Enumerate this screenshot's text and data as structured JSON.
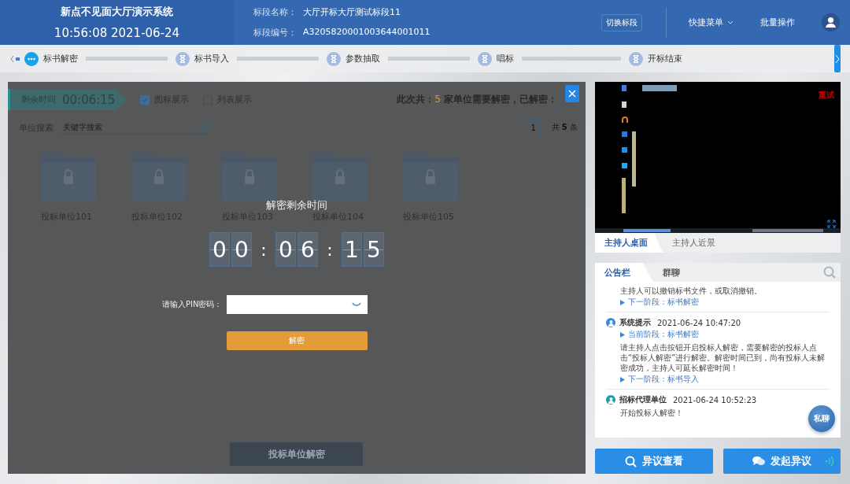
{
  "header": {
    "system_title": "新点不见面大厅演示系统",
    "clock": "10:56:08 2021-06-24",
    "fields": [
      {
        "label": "标段名称：",
        "value": "大厅开标大厅测试标段11"
      },
      {
        "label": "标段编号：",
        "value": "A3205820001003644001011"
      }
    ],
    "switch_button": "切换标段",
    "quick_menu": "快捷菜单",
    "batch_button": "批量操作"
  },
  "steps": [
    {
      "label": "标书解密",
      "current": true
    },
    {
      "label": "标书导入",
      "current": false
    },
    {
      "label": "参数抽取",
      "current": false
    },
    {
      "label": "唱标",
      "current": false
    },
    {
      "label": "开标结束",
      "current": false
    }
  ],
  "decrypt_panel": {
    "countdown": {
      "label": "剩余时间",
      "value": "00:06:15"
    },
    "view_options": [
      {
        "label": "图标展示",
        "checked": true
      },
      {
        "label": "列表展示",
        "checked": false
      }
    ],
    "summary": "此次共：**5** 家单位需要解密，已解密：",
    "search": {
      "label": "单位搜索",
      "placeholder": "关键字搜索"
    },
    "pagination": {
      "page": "1",
      "total": "共 **5** 条"
    },
    "bidders": [
      {
        "name": "投标单位101"
      },
      {
        "name": "投标单位102"
      },
      {
        "name": "投标单位103"
      },
      {
        "name": "投标单位104"
      },
      {
        "name": "投标单位105"
      }
    ],
    "action_button": "投标单位解密"
  },
  "dialog": {
    "title": "解密剩余时间",
    "timer": {
      "groups": [
        [
          "0",
          "0"
        ],
        [
          "0",
          "6"
        ],
        [
          "1",
          "5"
        ]
      ],
      "separator": ":"
    },
    "pin_label": "请输入PIN密码：",
    "decrypt_button": "解密"
  },
  "video": {
    "status": "重试",
    "tabs": [
      {
        "label": "主持人桌面",
        "selected": true
      },
      {
        "label": "主持人近景",
        "selected": false
      }
    ]
  },
  "board": {
    "tabs": [
      {
        "label": "公告栏",
        "selected": true
      },
      {
        "label": "群聊",
        "selected": false
      }
    ],
    "messages": [
      {
        "text": "主持人可以撤销标书文件，或取消撤销。",
        "next_stage": "下一阶段：标书解密"
      },
      {
        "sender": "系统提示",
        "time": "2021-06-24 10:47:20",
        "color": "#3f86d6",
        "current_stage": "当前阶段：标书解密",
        "text": "请主持人点击按钮开启投标人解密，需要解密的投标人点击“投标人解密”进行解密。解密时间已到，尚有投标人未解密成功，主持人可延长解密时间！",
        "next_stage": "下一阶段：标书导入"
      },
      {
        "sender": "招标代理单位",
        "time": "2021-06-24 10:52:23",
        "color": "#1e9bab",
        "text": "开始投标人解密！"
      }
    ],
    "private_chat": "私聊"
  },
  "actions": [
    {
      "label": "异议查看",
      "kind": "view"
    },
    {
      "label": "发起异议",
      "kind": "raise"
    }
  ]
}
